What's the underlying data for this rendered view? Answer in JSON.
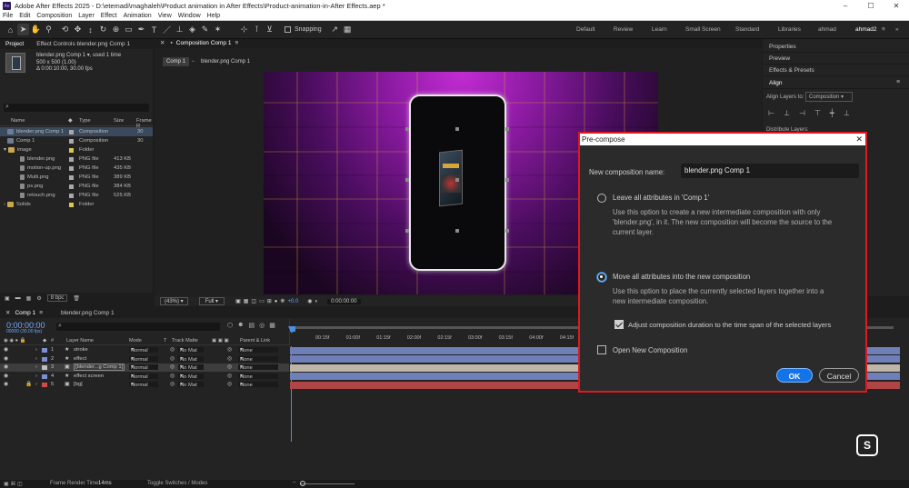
{
  "app": {
    "title": "Adobe After Effects 2025 - D:\\etemadi\\maghaleh\\Product animation in After Effects\\Product-animation-in-After Effects.aep *",
    "logo": "Ae"
  },
  "menu": [
    "File",
    "Edit",
    "Composition",
    "Layer",
    "Effect",
    "Animation",
    "View",
    "Window",
    "Help"
  ],
  "toolbar": {
    "snapping": "Snapping"
  },
  "workspaces": [
    "Default",
    "Review",
    "Learn",
    "Small Screen",
    "Standard",
    "Libraries",
    "ahmad",
    "ahmad2"
  ],
  "project": {
    "tab": "Project",
    "effects_tab": "Effect Controls blender.png Comp 1",
    "selected_name": "blender.png Comp 1",
    "used": ", used 1 time",
    "dims": "500 x 500 (1.00)",
    "duration": "Δ 0:00:10:00, 30.00 fps",
    "search_placeholder": "",
    "cols": {
      "name": "Name",
      "type": "Type",
      "size": "Size",
      "frame": "Frame R"
    },
    "rows": [
      {
        "name": "blender.png Comp 1",
        "type": "Composition",
        "size": "",
        "fr": "30",
        "kind": "comp",
        "swatch": "#a9a9a9",
        "indent": 0
      },
      {
        "name": "Comp 1",
        "type": "Composition",
        "size": "",
        "fr": "30",
        "kind": "comp",
        "swatch": "#a9a9a9",
        "indent": 0
      },
      {
        "name": "image",
        "type": "Folder",
        "size": "",
        "fr": "",
        "kind": "folder",
        "swatch": "#d8c94a",
        "indent": 0
      },
      {
        "name": "blender.png",
        "type": "PNG file",
        "size": "413 KB",
        "fr": "",
        "kind": "img",
        "swatch": "#a9a9a9",
        "indent": 1
      },
      {
        "name": "motion-up.png",
        "type": "PNG file",
        "size": "435 KB",
        "fr": "",
        "kind": "img",
        "swatch": "#a9a9a9",
        "indent": 1
      },
      {
        "name": "Multi.png",
        "type": "PNG file",
        "size": "389 KB",
        "fr": "",
        "kind": "img",
        "swatch": "#a9a9a9",
        "indent": 1
      },
      {
        "name": "ps.png",
        "type": "PNG file",
        "size": "384 KB",
        "fr": "",
        "kind": "img",
        "swatch": "#a9a9a9",
        "indent": 1
      },
      {
        "name": "retouch.png",
        "type": "PNG file",
        "size": "525 KB",
        "fr": "",
        "kind": "img",
        "swatch": "#a9a9a9",
        "indent": 1
      },
      {
        "name": "Solids",
        "type": "Folder",
        "size": "",
        "fr": "",
        "kind": "folder",
        "swatch": "#d8c94a",
        "indent": 0
      }
    ],
    "bpc": "8 bpc"
  },
  "viewer": {
    "tab": "Composition Comp 1",
    "crumb_comp": "Comp 1",
    "crumb_child": "blender.png Comp 1",
    "zoom": "(43%)",
    "resolution": "Full",
    "exposure": "+0.0",
    "timecode": "0:00:00:00"
  },
  "right_panel": {
    "items": [
      "Properties",
      "Preview",
      "Effects & Presets",
      "Align"
    ],
    "align_to_label": "Align Layers to:",
    "align_to_value": "Composition",
    "distribute": "Distribute Layers:"
  },
  "dialog": {
    "title": "Pre-compose",
    "name_label": "New composition name:",
    "name_value": "blender.png Comp 1",
    "opt1_label": "Leave all attributes in 'Comp 1'",
    "opt1_desc": [
      "Use this option to create a new intermediate composition with only",
      "'blender.png', in it. The new composition will become the source to the",
      "current layer."
    ],
    "opt2_label": "Move all attributes into the new composition",
    "opt2_desc": [
      "Use this option to place the currently selected layers together into a",
      "new intermediate composition."
    ],
    "adjust_label": "Adjust composition duration to the time span of the selected layers",
    "open_label": "Open New Composition",
    "ok": "OK",
    "cancel": "Cancel"
  },
  "timeline": {
    "tab1": "Comp 1",
    "tab2": "blender.png Comp 1",
    "timecode": "0:00:00:00",
    "timecode_sub": "00000 (30.00 fps)",
    "cols": {
      "layer_name": "Layer Name",
      "mode": "Mode",
      "t": "T",
      "track_matte": "Track Matte",
      "parent": "Parent & Link"
    },
    "ruler": [
      "00:15f",
      "01:00f",
      "01:15f",
      "02:00f",
      "02:15f",
      "03:00f",
      "03:15f",
      "04:00f",
      "04:15f"
    ],
    "layers": [
      {
        "num": "1",
        "name": "stroke",
        "mode": "Normal",
        "matte": "No Mat",
        "parent": "None",
        "label": "#7c8fd6",
        "bar": "#6f7fb8",
        "star": true
      },
      {
        "num": "2",
        "name": "effect",
        "mode": "Normal",
        "matte": "No Mat",
        "parent": "None",
        "label": "#7c8fd6",
        "bar": "#6f7fb8",
        "star": true
      },
      {
        "num": "3",
        "name": "[blender...g Comp 1]",
        "mode": "Normal",
        "matte": "No Mat",
        "parent": "None",
        "label": "#bfbfbf",
        "bar": "#bdb6a6",
        "star": false
      },
      {
        "num": "4",
        "name": "effect screen",
        "mode": "Normal",
        "matte": "No Mat",
        "parent": "None",
        "label": "#7c8fd6",
        "bar": "#6f7fb8",
        "star": true
      },
      {
        "num": "5",
        "name": "[bg]",
        "mode": "Normal",
        "matte": "No Mat",
        "parent": "None",
        "label": "#d14a4a",
        "bar": "#b04545",
        "star": false
      }
    ]
  },
  "status": {
    "render_label": "Frame Render Time:",
    "render_value": "14ms",
    "toggle": "Toggle Switches / Modes"
  }
}
